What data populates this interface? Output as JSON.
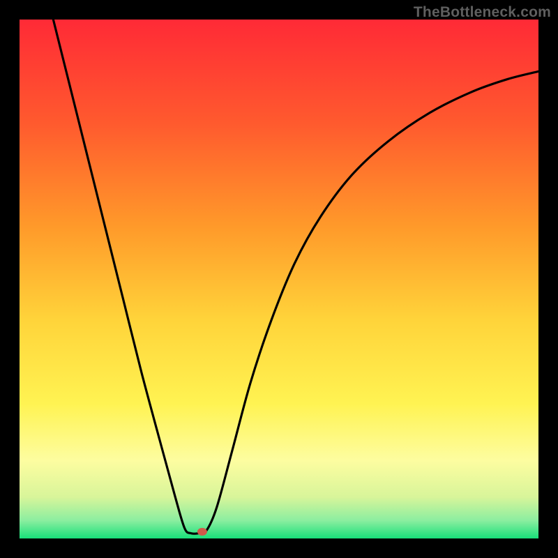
{
  "watermark": "TheBottleneck.com",
  "chart_data": {
    "type": "line",
    "title": "",
    "xlabel": "",
    "ylabel": "",
    "xlim": [
      0,
      1
    ],
    "ylim": [
      0,
      1
    ],
    "gradient_stops": [
      {
        "offset": 0.0,
        "color": "#ff2a36"
      },
      {
        "offset": 0.2,
        "color": "#ff5a2e"
      },
      {
        "offset": 0.4,
        "color": "#ff9a2a"
      },
      {
        "offset": 0.58,
        "color": "#ffd43a"
      },
      {
        "offset": 0.74,
        "color": "#fff352"
      },
      {
        "offset": 0.85,
        "color": "#fdfda0"
      },
      {
        "offset": 0.92,
        "color": "#d8f59a"
      },
      {
        "offset": 0.965,
        "color": "#8ceea0"
      },
      {
        "offset": 1.0,
        "color": "#18e07a"
      }
    ],
    "series": [
      {
        "name": "curve",
        "points": [
          {
            "x": 0.065,
            "y": 1.0
          },
          {
            "x": 0.095,
            "y": 0.88
          },
          {
            "x": 0.13,
            "y": 0.74
          },
          {
            "x": 0.165,
            "y": 0.6
          },
          {
            "x": 0.2,
            "y": 0.46
          },
          {
            "x": 0.235,
            "y": 0.32
          },
          {
            "x": 0.27,
            "y": 0.19
          },
          {
            "x": 0.3,
            "y": 0.08
          },
          {
            "x": 0.318,
            "y": 0.02
          },
          {
            "x": 0.33,
            "y": 0.01
          },
          {
            "x": 0.345,
            "y": 0.01
          },
          {
            "x": 0.36,
            "y": 0.015
          },
          {
            "x": 0.38,
            "y": 0.06
          },
          {
            "x": 0.41,
            "y": 0.17
          },
          {
            "x": 0.445,
            "y": 0.3
          },
          {
            "x": 0.485,
            "y": 0.42
          },
          {
            "x": 0.53,
            "y": 0.53
          },
          {
            "x": 0.58,
            "y": 0.62
          },
          {
            "x": 0.64,
            "y": 0.7
          },
          {
            "x": 0.71,
            "y": 0.765
          },
          {
            "x": 0.79,
            "y": 0.82
          },
          {
            "x": 0.87,
            "y": 0.86
          },
          {
            "x": 0.94,
            "y": 0.885
          },
          {
            "x": 1.0,
            "y": 0.9
          }
        ]
      }
    ],
    "marker": {
      "x": 0.352,
      "y": 0.013,
      "color": "#d05a4a"
    }
  }
}
